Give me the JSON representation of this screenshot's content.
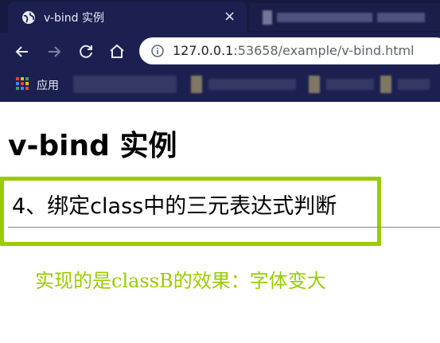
{
  "browser": {
    "tab_title": "v-bind 实例",
    "tab_close": "×",
    "url_host": "127.0.0.1",
    "url_rest": ":53658/example/v-bind.html",
    "bookmarks_apps_label": "应用",
    "icons": {
      "back": "arrow-left-icon",
      "forward": "arrow-right-icon",
      "reload": "reload-icon",
      "home": "home-icon",
      "info": "info-icon",
      "apps": "apps-grid-icon",
      "favicon": "globe-icon"
    }
  },
  "page": {
    "heading": "v-bind 实例",
    "section_title": "4、绑定class中的三元表达式判断",
    "result_text": "实现的是classB的效果：字体变大",
    "accent_color": "#99cc00"
  }
}
